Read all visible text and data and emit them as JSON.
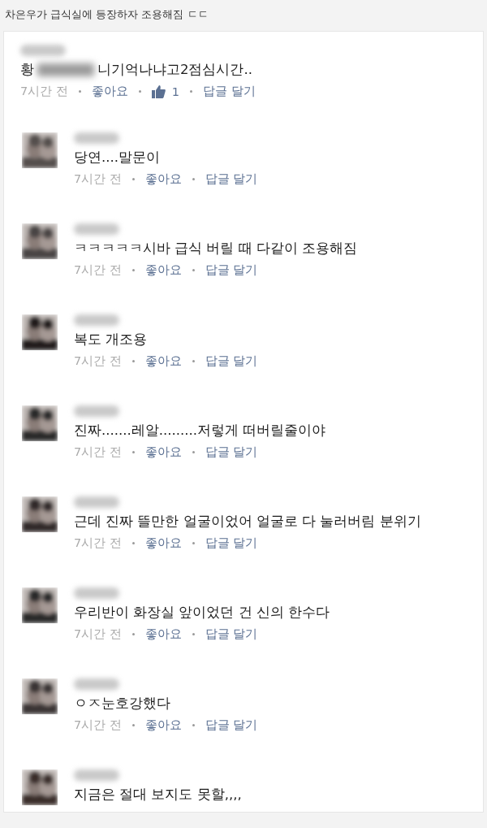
{
  "title": "차은우가 급식실에 등장하자 조용해짐 ㄷㄷ",
  "comments": [
    {
      "kind": "plain",
      "prefix": "황",
      "text": "니기억나냐고2점심시간..",
      "time": "7시간 전",
      "like": "좋아요",
      "like_count": "1",
      "reply": "답글 달기"
    },
    {
      "kind": "avatar",
      "text": "당연....말문이",
      "time": "7시간 전",
      "like": "좋아요",
      "reply": "답글 달기"
    },
    {
      "kind": "avatar",
      "text": "ㅋㅋㅋㅋㅋ시바 급식 버릴 때 다같이 조용해짐",
      "time": "7시간 전",
      "like": "좋아요",
      "reply": "답글 달기"
    },
    {
      "kind": "avatar",
      "text": "복도 개조용",
      "time": "7시간 전",
      "like": "좋아요",
      "reply": "답글 달기"
    },
    {
      "kind": "avatar",
      "text": "진짜.......레알.........저렇게 떠버릴줄이야",
      "time": "7시간 전",
      "like": "좋아요",
      "reply": "답글 달기"
    },
    {
      "kind": "avatar",
      "text": "근데 진짜 뜰만한 얼굴이었어 얼굴로 다 눌러버림 분위기",
      "time": "7시간 전",
      "like": "좋아요",
      "reply": "답글 달기"
    },
    {
      "kind": "avatar",
      "text": "우리반이 화장실 앞이었던 건 신의 한수다",
      "time": "7시간 전",
      "like": "좋아요",
      "reply": "답글 달기"
    },
    {
      "kind": "avatar",
      "text": "ㅇㅈ눈호강했다",
      "time": "7시간 전",
      "like": "좋아요",
      "reply": "답글 달기"
    },
    {
      "kind": "avatar",
      "text": "지금은 절대 보지도 못할,,,,"
    }
  ]
}
